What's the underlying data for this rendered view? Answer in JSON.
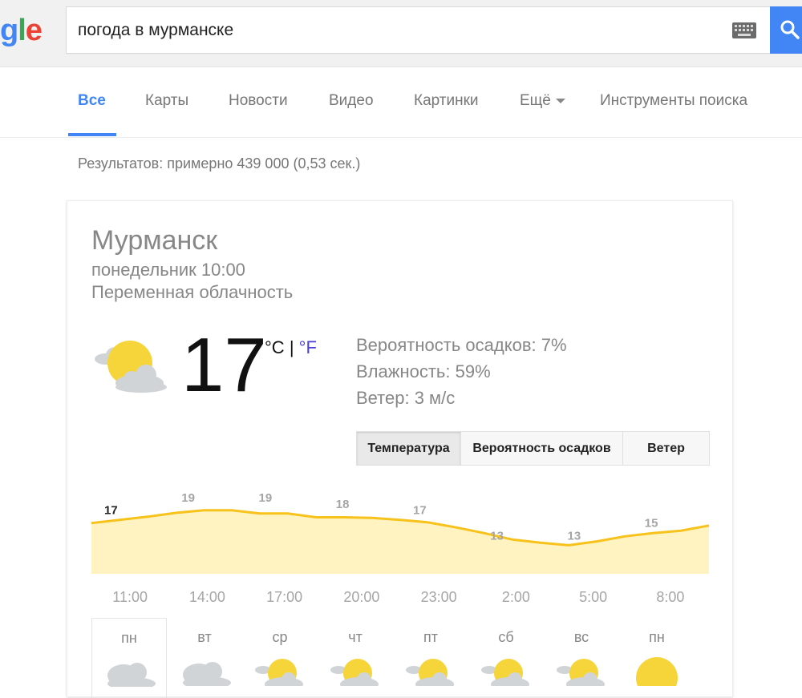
{
  "search": {
    "logo_text": [
      "g",
      "l",
      "e"
    ],
    "query": "погода в мурманске",
    "keyboard_icon": "keyboard-icon",
    "search_icon": "search-icon",
    "accent_color": "#4285f4"
  },
  "nav": {
    "items": [
      {
        "label": "Все",
        "active": true
      },
      {
        "label": "Карты",
        "active": false
      },
      {
        "label": "Новости",
        "active": false
      },
      {
        "label": "Видео",
        "active": false
      },
      {
        "label": "Картинки",
        "active": false
      },
      {
        "label": "Ещё",
        "active": false
      },
      {
        "label": "Инструменты поиска",
        "active": false
      }
    ]
  },
  "results_stats": "Результатов: примерно 439 000 (0,53 сек.)",
  "weather": {
    "city": "Мурманск",
    "datetime": "понедельник 10:00",
    "condition": "Переменная облачность",
    "current_icon": "partly-cloudy-icon",
    "temperature": "17",
    "unit_c": "°C",
    "unit_separator": "|",
    "unit_f": "°F",
    "precipitation": "Вероятность осадков: 7%",
    "humidity": "Влажность: 59%",
    "wind": "Ветер: 3 м/с",
    "tabs": [
      {
        "label": "Температура",
        "active": true
      },
      {
        "label": "Вероятность осадков",
        "active": false
      },
      {
        "label": "Ветер",
        "active": false
      }
    ],
    "days": [
      {
        "label": "пн",
        "icon": "cloudy-icon",
        "selected": true
      },
      {
        "label": "вт",
        "icon": "cloudy-icon",
        "selected": false
      },
      {
        "label": "ср",
        "icon": "partly-cloudy-icon",
        "selected": false
      },
      {
        "label": "чт",
        "icon": "partly-cloudy-icon",
        "selected": false
      },
      {
        "label": "пт",
        "icon": "partly-cloudy-icon",
        "selected": false
      },
      {
        "label": "сб",
        "icon": "partly-cloudy-icon",
        "selected": false
      },
      {
        "label": "вс",
        "icon": "partly-cloudy-icon",
        "selected": false
      },
      {
        "label": "пн",
        "icon": "sunny-icon",
        "selected": false
      }
    ],
    "colors": {
      "sun": "#f6d53b",
      "cloud": "#d0d4d6",
      "chart_line": "#f7c21b",
      "chart_fill": "#fff4c1"
    }
  },
  "chart_data": {
    "type": "area",
    "x": [
      "11:00",
      "14:00",
      "17:00",
      "20:00",
      "23:00",
      "2:00",
      "5:00",
      "8:00"
    ],
    "labels": [
      "17",
      "19",
      "19",
      "18",
      "17",
      "13",
      "13",
      "15"
    ],
    "values": [
      17,
      19,
      19,
      18,
      17,
      13,
      13,
      15
    ],
    "curve": [
      17,
      17.5,
      18,
      18.6,
      19,
      19,
      18.5,
      18.5,
      17.9,
      17.9,
      17.8,
      17.5,
      17.1,
      16.3,
      15.4,
      14.4,
      13.9,
      13.5,
      14.1,
      14.9,
      15.4,
      15.8,
      16.6
    ],
    "ylim": [
      9,
      21
    ],
    "grid": false,
    "legend": "none"
  }
}
